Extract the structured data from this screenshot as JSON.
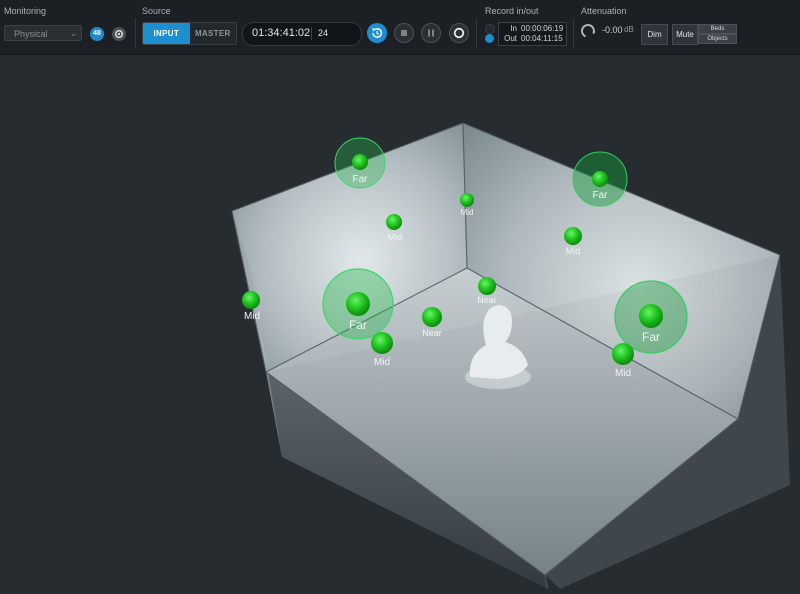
{
  "toolbar": {
    "monitoring": {
      "label": "Monitoring",
      "select_value": "Physical",
      "channels_badge": "48"
    },
    "source": {
      "label": "Source",
      "input_label": "INPUT",
      "master_label": "MASTER",
      "active": "INPUT"
    },
    "timecode": {
      "time": "01:34:41:02",
      "frame_rate": "24"
    },
    "transport": {
      "buttons": [
        "loop-icon",
        "stop-icon",
        "pause-icon",
        "record-icon"
      ]
    },
    "record_inout": {
      "label": "Record in/out",
      "in_label": "In",
      "in_value": "00:00:06:19",
      "out_label": "Out",
      "out_value": "00:04:11:15"
    },
    "attenuation": {
      "label": "Attenuation",
      "value": "-0.00",
      "unit": "dB",
      "dim_label": "Dim",
      "mute_label": "Mute",
      "beds_label": "Beds",
      "objects_label": "Objects"
    }
  },
  "scene": {
    "objects": [
      {
        "label": "Far"
      },
      {
        "label": "Far"
      },
      {
        "label": "Mid"
      },
      {
        "label": "Mid"
      },
      {
        "label": "Mid"
      },
      {
        "label": "Near"
      },
      {
        "label": "Mid"
      },
      {
        "label": "Far"
      },
      {
        "label": "Near"
      },
      {
        "label": "Mid"
      },
      {
        "label": "Far"
      },
      {
        "label": "Mid"
      }
    ],
    "colors": {
      "object": "#1ec81e",
      "halo": "#22b84a",
      "room": "#8d9aa0",
      "background": "#272c31"
    }
  }
}
